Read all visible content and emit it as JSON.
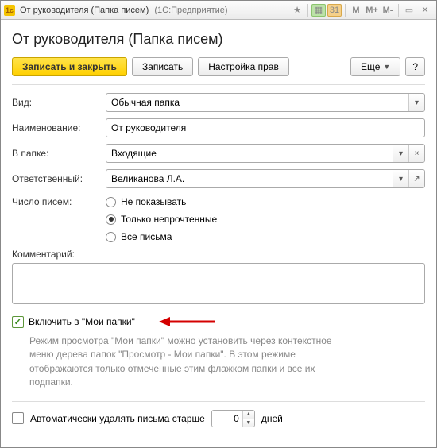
{
  "window": {
    "title": "От руководителя (Папка писем)",
    "subtitle": "(1С:Предприятие)"
  },
  "heading": "От руководителя (Папка писем)",
  "toolbar": {
    "save_close": "Записать и закрыть",
    "save": "Записать",
    "rights": "Настройка прав",
    "more": "Еще",
    "help": "?"
  },
  "fields": {
    "kind_label": "Вид:",
    "kind_value": "Обычная папка",
    "name_label": "Наименование:",
    "name_value": "От руководителя",
    "folder_label": "В папке:",
    "folder_value": "Входящие",
    "owner_label": "Ответственный:",
    "owner_value": "Великанова Л.А.",
    "count_label": "Число писем:",
    "radios": {
      "none": "Не показывать",
      "unread": "Только непрочтенные",
      "all": "Все письма",
      "selected": "unread"
    },
    "comment_label": "Комментарий:",
    "comment_value": ""
  },
  "include": {
    "label": "Включить в \"Мои папки\"",
    "checked": true,
    "hint": "Режим просмотра \"Мои папки\" можно установить через контекстное меню дерева папок \"Просмотр - Мои папки\". В этом режиме отображаются только отмеченные этим флажком папки и все их подпапки."
  },
  "auto_delete": {
    "label": "Автоматически удалять письма старше",
    "value": "0",
    "unit": "дней",
    "checked": false
  }
}
